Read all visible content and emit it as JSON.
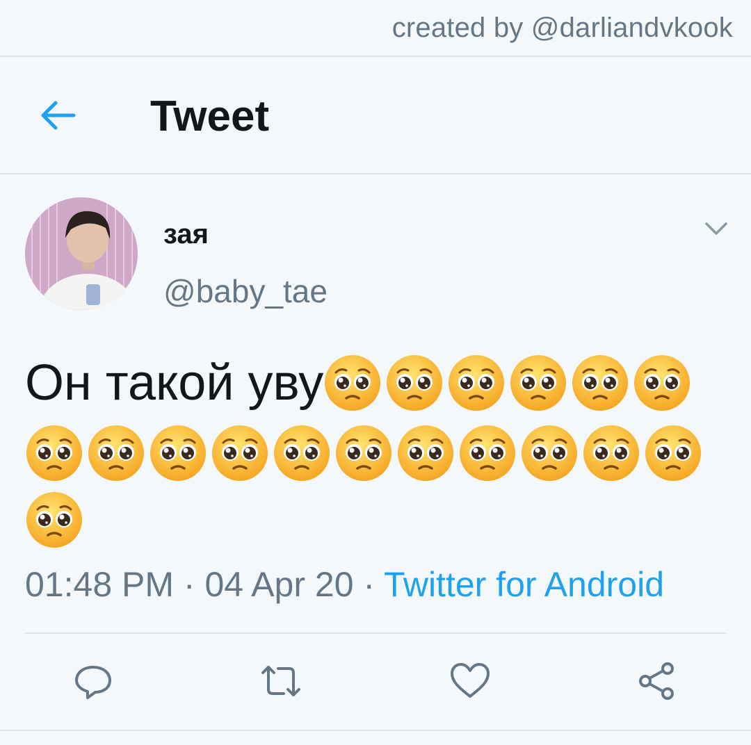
{
  "watermark": "created by @darliandvkook",
  "header": {
    "title": "Tweet",
    "back_icon": "arrow-left-icon"
  },
  "tweet": {
    "display_name": "зая",
    "handle": "@baby_tae",
    "text": "Он такой уву",
    "emoji_name": "pleading-face-icon",
    "emoji_count": 18,
    "time": "01:48 PM",
    "date": "04 Apr 20",
    "separator": " · ",
    "source": "Twitter for Android"
  },
  "actions": [
    {
      "name": "reply-icon"
    },
    {
      "name": "retweet-icon"
    },
    {
      "name": "like-icon"
    },
    {
      "name": "share-icon"
    }
  ],
  "colors": {
    "accent": "#1da1f2",
    "text_primary": "#14171a",
    "text_secondary": "#657786",
    "background": "#f5f8fa",
    "divider": "#dde3e8"
  }
}
